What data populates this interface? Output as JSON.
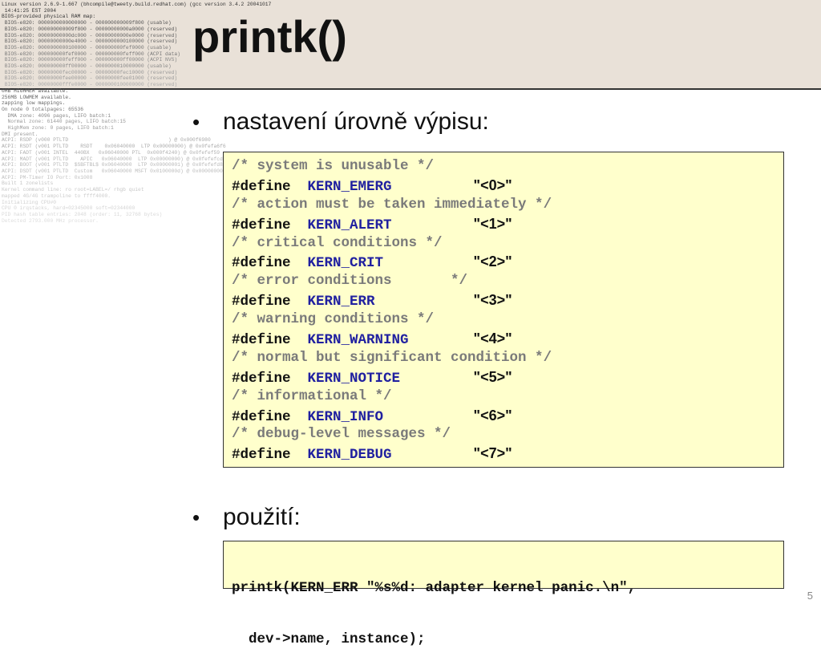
{
  "slide": {
    "title": "printk()",
    "page_number": "5",
    "bullets": [
      {
        "marker": "•",
        "text": "nastavení úrovně výpisu:"
      },
      {
        "marker": "•",
        "text": "použití:"
      }
    ],
    "boot_log": [
      {
        "text": "Linux version 2.6.9-1.667 (bhcompile@tweety.build.redhat.com) (gcc version 3.4.2 20041017",
        "color": "#333333"
      },
      {
        "text": " 14:41:25 EST 2004",
        "color": "#333333"
      },
      {
        "text": "BIOS-provided physical RAM map:",
        "color": "#333333"
      },
      {
        "text": " BIOS-e820: 0000000000000000 - 000000000009f800 (usable)",
        "color": "#555555"
      },
      {
        "text": " BIOS-e820: 000000000009f800 - 00000000000a0000 (reserved)",
        "color": "#555555"
      },
      {
        "text": " BIOS-e820: 00000000000dc000 - 00000000000e0000 (reserved)",
        "color": "#666666"
      },
      {
        "text": " BIOS-e820: 00000000000e4000 - 0000000000100000 (reserved)",
        "color": "#666666"
      },
      {
        "text": " BIOS-e820: 0000000000100000 - 000000000fef0000 (usable)",
        "color": "#777777"
      },
      {
        "text": " BIOS-e820: 000000000fef0000 - 000000000feff000 (ACPI data)",
        "color": "#777777"
      },
      {
        "text": " BIOS-e820: 000000000feff000 - 000000000ff00000 (ACPI NVS)",
        "color": "#888888"
      },
      {
        "text": " BIOS-e820: 000000000ff00000 - 0000000010000000 (usable)",
        "color": "#888888"
      },
      {
        "text": " BIOS-e820: 00000000fec00000 - 00000000fec10000 (reserved)",
        "color": "#999999"
      },
      {
        "text": " BIOS-e820: 00000000fee00000 - 00000000fee01000 (reserved)",
        "color": "#999999"
      },
      {
        "text": " BIOS-e820: 00000000fffe0000 - 0000000100000000 (reserved)",
        "color": "#aaaaaa"
      },
      {
        "text": "0MB HIGHMEM available.",
        "color": "#555555"
      },
      {
        "text": "256MB LOWMEM available.",
        "color": "#666666"
      },
      {
        "text": "zapping low mappings.",
        "color": "#666666"
      },
      {
        "text": "On node 0 totalpages: 65536",
        "color": "#777777"
      },
      {
        "text": "  DMA zone: 4096 pages, LIFO batch:1",
        "color": "#888888"
      },
      {
        "text": "  Normal zone: 61440 pages, LIFO batch:15",
        "color": "#999999"
      },
      {
        "text": "  HighMem zone: 0 pages, LIFO batch:1",
        "color": "#999999"
      },
      {
        "text": "DMI present.",
        "color": "#999999"
      },
      {
        "text": "ACPI: RSDP (v000 PTLTD                                 ) @ 0x000f6980",
        "color": "#aaaaaa"
      },
      {
        "text": "ACPI: RSDT (v001 PTLTD    RSDT    0x06040000  LTP 0x00000000) @ 0x0fefa6f6",
        "color": "#aaaaaa"
      },
      {
        "text": "ACPI: FADT (v001 INTEL  440BX   0x06040000 PTL  0x000f4240) @ 0x0fefef59",
        "color": "#b0b0b0"
      },
      {
        "text": "ACPI: MADT (v001 PTLTD    APIC   0x06040000  LTP 0x00000000) @ 0x0fefefcd",
        "color": "#b5b5b5"
      },
      {
        "text": "ACPI: BOOT (v001 PTLTD  $SBFTBL$ 0x06040000  LTP 0x00000001) @ 0x0fefefd8",
        "color": "#b8b8b8"
      },
      {
        "text": "ACPI: DSDT (v001 PTLTD  Custom   0x06040000 MSFT 0x0100000d) @ 0x00000000",
        "color": "#bbbbbb"
      },
      {
        "text": "ACPI: PM-Timer IO Port: 0x1008",
        "color": "#c0c0c0"
      },
      {
        "text": "Built 1 zonelists",
        "color": "#c4c4c4"
      },
      {
        "text": "Kernel command line: ro root=LABEL=/ rhgb quiet",
        "color": "#c8c8c8"
      },
      {
        "text": "mapped 4G/4G trampoline to ffff4000.",
        "color": "#cccccc"
      },
      {
        "text": "Initializing CPU#0",
        "color": "#d0d0d0"
      },
      {
        "text": "CPU 0 irqstacks, hard=02345000 soft=02344000",
        "color": "#d4d4d4"
      },
      {
        "text": "PID hash table entries: 2048 (order: 11, 32768 bytes)",
        "color": "#d8d8d8"
      },
      {
        "text": "Detected 2793.000 MHz processor.",
        "color": "#dcdcdc"
      }
    ]
  },
  "level_definitions": [
    {
      "comment": "/* system is unusable */",
      "keyword": "#define",
      "macro": "KERN_EMERG",
      "value": "\"<0>\""
    },
    {
      "comment": "/* action must be taken immediately */",
      "keyword": "#define",
      "macro": "KERN_ALERT",
      "value": "\"<1>\""
    },
    {
      "comment": "/* critical conditions */",
      "keyword": "#define",
      "macro": "KERN_CRIT",
      "value": "\"<2>\""
    },
    {
      "comment": "/* error conditions       */",
      "keyword": "#define",
      "macro": "KERN_ERR",
      "value": "\"<3>\""
    },
    {
      "comment": "/* warning conditions */",
      "keyword": "#define",
      "macro": "KERN_WARNING",
      "value": "\"<4>\""
    },
    {
      "comment": "/* normal but significant condition */",
      "keyword": "#define",
      "macro": "KERN_NOTICE",
      "value": "\"<5>\""
    },
    {
      "comment": "/* informational */",
      "keyword": "#define",
      "macro": "KERN_INFO",
      "value": "\"<6>\""
    },
    {
      "comment": "/* debug-level messages */",
      "keyword": "#define",
      "macro": "KERN_DEBUG",
      "value": "\"<7>\""
    }
  ],
  "usage_code": [
    "printk(KERN_ERR \"%s%d: adapter kernel panic.\\n\",",
    "  dev->name, instance);"
  ]
}
